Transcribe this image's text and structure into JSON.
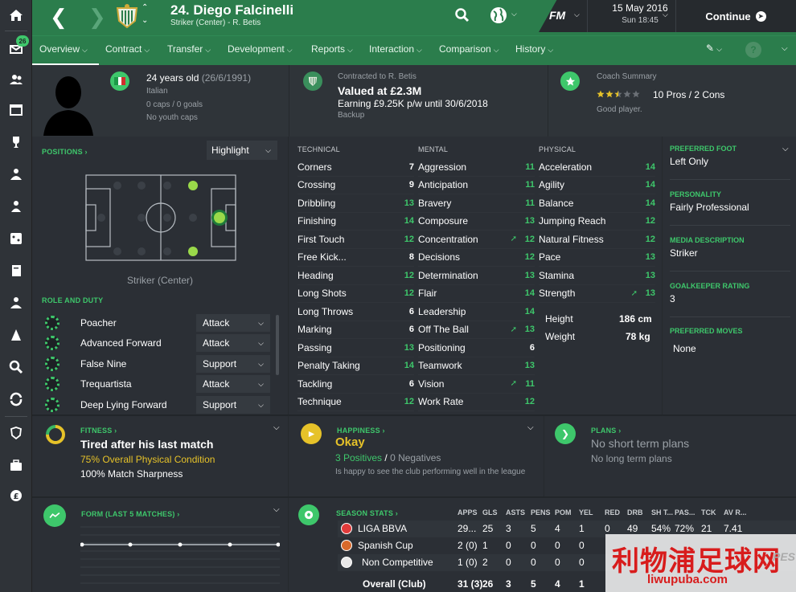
{
  "header": {
    "title": "24. Diego Falcinelli",
    "subtitle": "Striker (Center) - R. Betis",
    "fm_logo": "FM",
    "date": "15 May 2016",
    "time": "Sun 18:45",
    "continue_label": "Continue"
  },
  "sidebar": {
    "inbox_badge": "26"
  },
  "tabs": [
    "Overview",
    "Contract",
    "Transfer",
    "Development",
    "Reports",
    "Interaction",
    "Comparison",
    "History"
  ],
  "bio": {
    "age": "24 years old",
    "dob": "(26/6/1991)",
    "nationality": "Italian",
    "caps": "0 caps / 0 goals",
    "youth": "No youth caps"
  },
  "contract": {
    "label": "Contracted to R. Betis",
    "value": "Valued at £2.3M",
    "earning": "Earning £9.25K p/w until 30/6/2018",
    "status": "Backup"
  },
  "coach": {
    "label": "Coach Summary",
    "stars": 2.5,
    "pros_cons": "10 Pros / 2 Cons",
    "verdict": "Good player."
  },
  "positions": {
    "title": "POSITIONS",
    "highlight_label": "Highlight",
    "position_label": "Striker (Center)"
  },
  "roles": {
    "title": "ROLE AND DUTY",
    "items": [
      {
        "name": "Poacher",
        "duty": "Attack"
      },
      {
        "name": "Advanced Forward",
        "duty": "Attack"
      },
      {
        "name": "False Nine",
        "duty": "Support"
      },
      {
        "name": "Trequartista",
        "duty": "Attack"
      },
      {
        "name": "Deep Lying Forward",
        "duty": "Support"
      }
    ]
  },
  "attributes": {
    "technical_title": "TECHNICAL",
    "mental_title": "MENTAL",
    "physical_title": "PHYSICAL",
    "technical": [
      {
        "name": "Corners",
        "value": "7",
        "up": false
      },
      {
        "name": "Crossing",
        "value": "9",
        "up": false
      },
      {
        "name": "Dribbling",
        "value": "13",
        "up": false
      },
      {
        "name": "Finishing",
        "value": "14",
        "up": false
      },
      {
        "name": "First Touch",
        "value": "12",
        "up": false
      },
      {
        "name": "Free Kick...",
        "value": "8",
        "up": false
      },
      {
        "name": "Heading",
        "value": "12",
        "up": false
      },
      {
        "name": "Long Shots",
        "value": "12",
        "up": false
      },
      {
        "name": "Long Throws",
        "value": "6",
        "up": false
      },
      {
        "name": "Marking",
        "value": "6",
        "up": false
      },
      {
        "name": "Passing",
        "value": "13",
        "up": false
      },
      {
        "name": "Penalty Taking",
        "value": "14",
        "up": false
      },
      {
        "name": "Tackling",
        "value": "6",
        "up": false
      },
      {
        "name": "Technique",
        "value": "12",
        "up": false
      }
    ],
    "mental": [
      {
        "name": "Aggression",
        "value": "11",
        "up": false
      },
      {
        "name": "Anticipation",
        "value": "11",
        "up": false
      },
      {
        "name": "Bravery",
        "value": "11",
        "up": false
      },
      {
        "name": "Composure",
        "value": "13",
        "up": false
      },
      {
        "name": "Concentration",
        "value": "12",
        "up": true
      },
      {
        "name": "Decisions",
        "value": "12",
        "up": false
      },
      {
        "name": "Determination",
        "value": "13",
        "up": false
      },
      {
        "name": "Flair",
        "value": "14",
        "up": false
      },
      {
        "name": "Leadership",
        "value": "14",
        "up": false
      },
      {
        "name": "Off The Ball",
        "value": "13",
        "up": true
      },
      {
        "name": "Positioning",
        "value": "6",
        "up": false
      },
      {
        "name": "Teamwork",
        "value": "13",
        "up": false
      },
      {
        "name": "Vision",
        "value": "11",
        "up": true
      },
      {
        "name": "Work Rate",
        "value": "12",
        "up": false
      }
    ],
    "physical": [
      {
        "name": "Acceleration",
        "value": "14",
        "up": false
      },
      {
        "name": "Agility",
        "value": "14",
        "up": false
      },
      {
        "name": "Balance",
        "value": "14",
        "up": false
      },
      {
        "name": "Jumping Reach",
        "value": "12",
        "up": false
      },
      {
        "name": "Natural Fitness",
        "value": "12",
        "up": false
      },
      {
        "name": "Pace",
        "value": "13",
        "up": false
      },
      {
        "name": "Stamina",
        "value": "13",
        "up": false
      },
      {
        "name": "Strength",
        "value": "13",
        "up": true
      }
    ],
    "height_label": "Height",
    "height": "186 cm",
    "weight_label": "Weight",
    "weight": "78 kg"
  },
  "info": {
    "foot_label": "PREFERRED FOOT",
    "foot": "Left Only",
    "personality_label": "PERSONALITY",
    "personality": "Fairly Professional",
    "media_label": "MEDIA DESCRIPTION",
    "media": "Striker",
    "gk_label": "GOALKEEPER RATING",
    "gk": "3",
    "moves_label": "PREFERRED MOVES",
    "moves": "None"
  },
  "fitness": {
    "title": "FITNESS",
    "headline": "Tired after his last match",
    "condition": "75% Overall Physical Condition",
    "sharpness": "100% Match Sharpness"
  },
  "happiness": {
    "title": "HAPPINESS",
    "headline": "Okay",
    "positives": "3 Positives",
    "sep": "/",
    "negatives": "0 Negatives",
    "note": "Is happy to see the club performing well in the league"
  },
  "plans": {
    "title": "PLANS",
    "short": "No short term plans",
    "long": "No long term plans"
  },
  "form": {
    "title": "FORM (LAST 5 MATCHES)"
  },
  "season": {
    "title": "SEASON STATS",
    "headers": [
      "APPS",
      "GLS",
      "ASTS",
      "PENS",
      "POM",
      "YEL",
      "RED",
      "DRB",
      "SH T...",
      "PAS...",
      "TCK",
      "AV R..."
    ],
    "rows": [
      {
        "comp": "LIGA BBVA",
        "vals": [
          "29...",
          "25",
          "3",
          "5",
          "4",
          "1",
          "0",
          "49",
          "54%",
          "72%",
          "21",
          "7.41"
        ]
      },
      {
        "comp": "Spanish Cup",
        "vals": [
          "2 (0)",
          "1",
          "0",
          "0",
          "0",
          "0",
          "",
          "",
          "",
          "",
          "",
          ""
        ]
      },
      {
        "comp": "Non Competitive",
        "vals": [
          "1 (0)",
          "2",
          "0",
          "0",
          "0",
          "0",
          "",
          "",
          "",
          "",
          "",
          ""
        ]
      }
    ],
    "total": {
      "comp": "Overall (Club)",
      "vals": [
        "31 (3)",
        "26",
        "3",
        "5",
        "4",
        "1"
      ]
    }
  },
  "watermark": {
    "cn": "利物浦足球网",
    "url": "liwupuba.com",
    "ghost": "PES"
  },
  "colors": {
    "accent": "#3ec76b",
    "topbar": "#2b7d4c",
    "panel": "#2b2f35",
    "happy": "#e6c229"
  }
}
